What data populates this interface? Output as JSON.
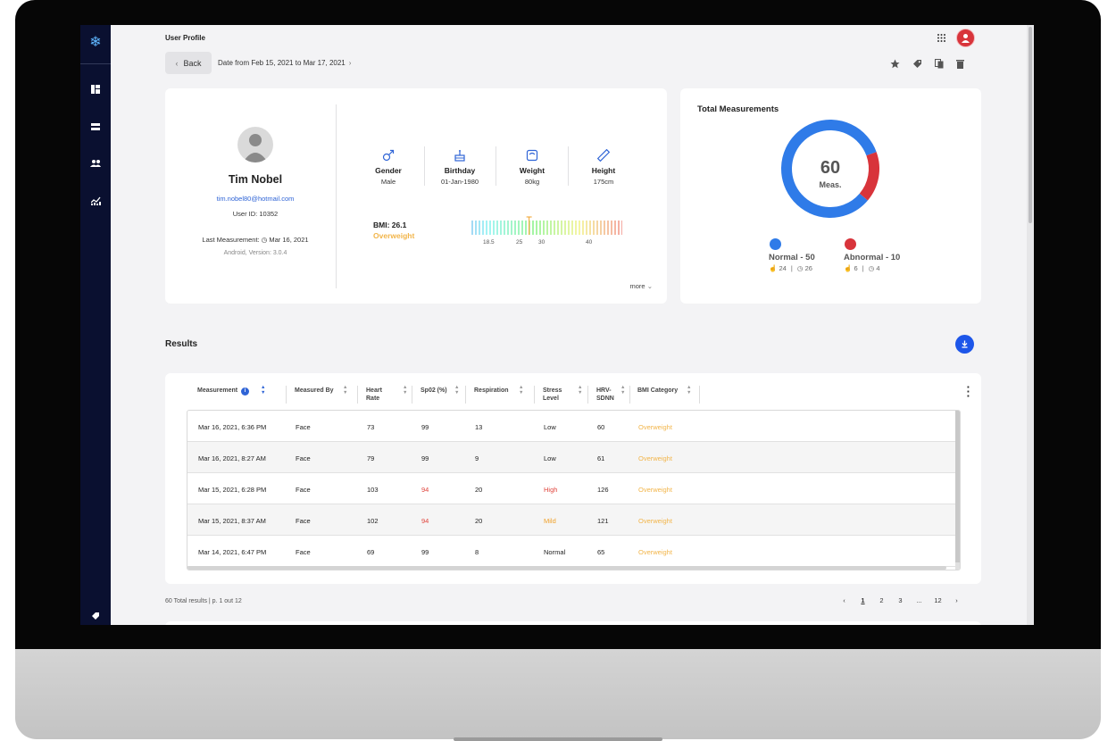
{
  "header": {
    "page_title": "User Profile",
    "back_label": "Back",
    "date_range": "Date from Feb 15, 2021 to Mar 17, 2021"
  },
  "profile": {
    "name": "Tim Nobel",
    "email": "tim.nobel80@hotmail.com",
    "user_id": "User ID: 10352",
    "last_measurement_label": "Last Measurement:",
    "last_measurement_date": "Mar 16, 2021",
    "device": "Android, Version: 3.0.4",
    "stats": [
      {
        "label": "Gender",
        "value": "Male"
      },
      {
        "label": "Birthday",
        "value": "01-Jan-1980"
      },
      {
        "label": "Weight",
        "value": "80kg"
      },
      {
        "label": "Height",
        "value": "175cm"
      }
    ],
    "bmi_value": "BMI: 26.1",
    "bmi_category": "Overweight",
    "bmi_ticks": [
      "18.5",
      "25",
      "30",
      "40"
    ],
    "bmi_level": 26.1,
    "more_label": "more"
  },
  "total": {
    "title": "Total Measurements",
    "count": "60",
    "unit": "Meas.",
    "normal_fraction": 0.833,
    "normal": {
      "label": "Normal - 50",
      "liked": "24",
      "other": "26",
      "color": "#2f7be8"
    },
    "abnormal": {
      "label": "Abnormal - 10",
      "liked": "6",
      "other": "4",
      "color": "#d8343b"
    }
  },
  "results": {
    "title": "Results",
    "columns": [
      "Measurement",
      "Measured By",
      "Heart Rate",
      "Sp02 (%)",
      "Respiration",
      "Stress Level",
      "HRV-SDNN",
      "BMI Category"
    ],
    "rows": [
      {
        "measurement": "Mar 16, 2021, 6:36 PM",
        "by": "Face",
        "hr": "73",
        "spo2": "99",
        "resp": "13",
        "stress": "Low",
        "hrv": "60",
        "bmi": "Overweight"
      },
      {
        "measurement": "Mar 16, 2021, 8:27 AM",
        "by": "Face",
        "hr": "79",
        "spo2": "99",
        "resp": "9",
        "stress": "Low",
        "hrv": "61",
        "bmi": "Overweight"
      },
      {
        "measurement": "Mar 15, 2021, 6:28 PM",
        "by": "Face",
        "hr": "103",
        "spo2": "94",
        "resp": "20",
        "stress": "High",
        "hrv": "126",
        "bmi": "Overweight"
      },
      {
        "measurement": "Mar 15, 2021, 8:37 AM",
        "by": "Face",
        "hr": "102",
        "spo2": "94",
        "resp": "20",
        "stress": "Mild",
        "hrv": "121",
        "bmi": "Overweight"
      },
      {
        "measurement": "Mar 14, 2021, 6:47 PM",
        "by": "Face",
        "hr": "69",
        "spo2": "99",
        "resp": "8",
        "stress": "Normal",
        "hrv": "65",
        "bmi": "Overweight"
      }
    ],
    "total_label": "60 Total results | p. 1 out 12",
    "pages": [
      "1",
      "2",
      "3",
      "...",
      "12"
    ],
    "colors": {
      "warn": "#f2b54a",
      "alert": "#e0473f",
      "mild": "#f0a12a"
    }
  }
}
